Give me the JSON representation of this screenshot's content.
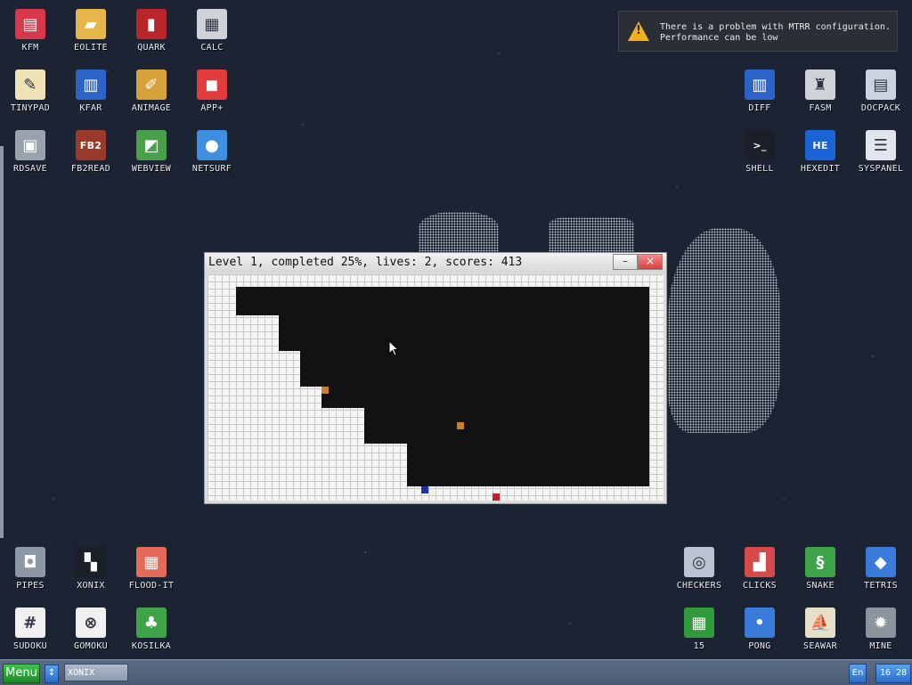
{
  "desktop": {
    "icons_top_left": [
      {
        "label": "KFM",
        "icon": "floppy-icon",
        "color": "#d9374a"
      },
      {
        "label": "EOLITE",
        "icon": "folder-icon",
        "color": "#e6b64a"
      },
      {
        "label": "QUARK",
        "icon": "notebook-icon",
        "color": "#b8262a"
      },
      {
        "label": "CALC",
        "icon": "calculator-icon",
        "color": "#cfd3d8"
      },
      {
        "label": "TINYPAD",
        "icon": "notepad-icon",
        "color": "#efe3b6"
      },
      {
        "label": "KFAR",
        "icon": "panels-icon",
        "color": "#2c63c8"
      },
      {
        "label": "ANIMAGE",
        "icon": "pencil-ruler-icon",
        "color": "#d8a23a"
      },
      {
        "label": "APP+",
        "icon": "cube-icon",
        "color": "#e23b3b"
      },
      {
        "label": "RDSAVE",
        "icon": "disk-save-icon",
        "color": "#9aa2ad"
      },
      {
        "label": "FB2READ",
        "icon": "book-icon",
        "color": "#9a3a2a"
      },
      {
        "label": "WEBVIEW",
        "icon": "globe-window-icon",
        "color": "#4aa04a"
      },
      {
        "label": "NETSURF",
        "icon": "globe-icon",
        "color": "#3e8fe0"
      }
    ],
    "icons_top_right": [
      {
        "label": "DIFF",
        "icon": "compare-icon",
        "color": "#2c63c8"
      },
      {
        "label": "FASM",
        "icon": "anvil-icon",
        "color": "#cfd3d8"
      },
      {
        "label": "DOCPACK",
        "icon": "cabinet-icon",
        "color": "#c9d4de"
      },
      {
        "label": "SHELL",
        "icon": "terminal-icon",
        "color": "#1a1f28"
      },
      {
        "label": "HEXEDIT",
        "icon": "hex-editor-icon",
        "color": "#1a64d8"
      },
      {
        "label": "SYSPANEL",
        "icon": "sliders-icon",
        "color": "#e0e6ec"
      }
    ],
    "icons_bottom_left": [
      {
        "label": "PIPES",
        "icon": "pipes-icon",
        "color": "#8c98a6"
      },
      {
        "label": "XONIX",
        "icon": "xonix-icon",
        "color": "#1a1f28"
      },
      {
        "label": "FLOOD-IT",
        "icon": "flood-grid-icon",
        "color": "#e56a5a"
      },
      {
        "label": "SUDOKU",
        "icon": "sudoku-icon",
        "color": "#f0f0f0"
      },
      {
        "label": "GOMOKU",
        "icon": "gomoku-icon",
        "color": "#f0f0f0"
      },
      {
        "label": "KOSILKA",
        "icon": "lawnmower-icon",
        "color": "#3fa34a"
      }
    ],
    "icons_bottom_right": [
      {
        "label": "CHECKERS",
        "icon": "checkers-icon",
        "color": "#b9c4d0"
      },
      {
        "label": "CLICKS",
        "icon": "blocks-icon",
        "color": "#d64a4a"
      },
      {
        "label": "SNAKE",
        "icon": "snake-icon",
        "color": "#3fa34a"
      },
      {
        "label": "TETRIS",
        "icon": "tetris-icon",
        "color": "#3a7ad8"
      },
      {
        "label": "15",
        "icon": "fifteen-grid-icon",
        "color": "#2e9a3a"
      },
      {
        "label": "PONG",
        "icon": "pong-icon",
        "color": "#3a7ad8"
      },
      {
        "label": "SEAWAR",
        "icon": "ship-icon",
        "color": "#e6e0c8"
      },
      {
        "label": "MINE",
        "icon": "mine-icon",
        "color": "#8c949e"
      }
    ]
  },
  "notification": {
    "line1": "There is a problem with MTRR configuration.",
    "line2": "Performance can be low",
    "icon": "warning-icon",
    "accent": "#f2b01e"
  },
  "game_window": {
    "title": "Level 1, completed 25%, lives: 2, scores: 413",
    "minimize_label": "–",
    "close_label": "×",
    "player_color": "#c0202a",
    "enemy_color": "#c88030",
    "land_enemy_color": "#2233aa"
  },
  "taskbar": {
    "menu_label": "Menu",
    "switch_label": "↕",
    "active_task": "XONIX",
    "lang": "En",
    "clock": "16 28"
  }
}
